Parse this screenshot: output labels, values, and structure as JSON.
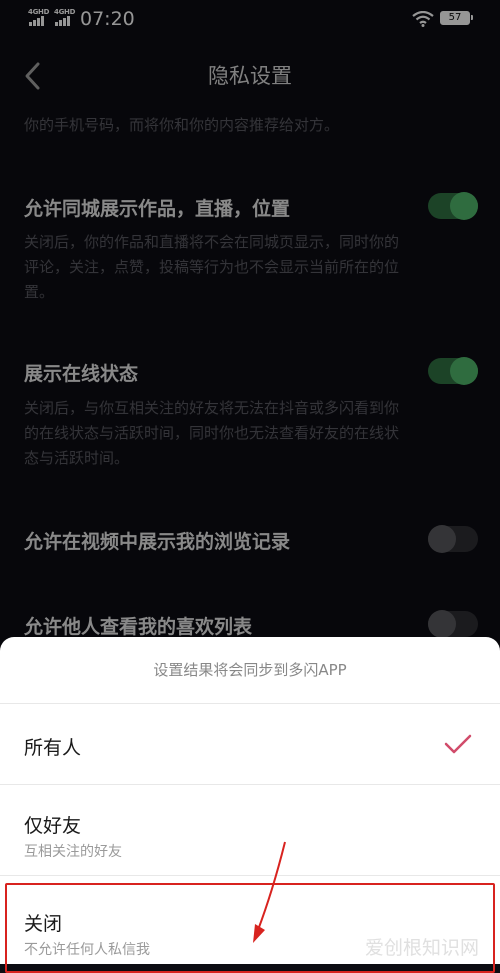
{
  "status_bar": {
    "signal_1_label": "4GHD",
    "signal_2_label": "4GHD",
    "time": "07:20",
    "battery": "57"
  },
  "nav": {
    "title": "隐私设置"
  },
  "settings": {
    "intro_text": "你的手机号码，而将你和你的内容推荐给对方。",
    "items": [
      {
        "title": "允许同城展示作品，直播，位置",
        "desc_lines": [
          "关闭后，你的作品和直播将不会在同城页显示，同时你的",
          "评论，关注，点赞，投稿等行为也不会显示当前所在的位",
          "置。"
        ],
        "enabled": true
      },
      {
        "title": "展示在线状态",
        "desc_lines": [
          "关闭后，与你互相关注的好友将无法在抖音或多闪看到你",
          "的在线状态与活跃时间，同时你也无法查看好友的在线状",
          "态与活跃时间。"
        ],
        "enabled": true
      },
      {
        "title": "允许在视频中展示我的浏览记录",
        "enabled": false
      },
      {
        "title": "允许他人查看我的喜欢列表",
        "enabled": false
      }
    ]
  },
  "sheet": {
    "header": "设置结果将会同步到多闪APP",
    "options": [
      {
        "label": "所有人",
        "selected": true
      },
      {
        "label": "仅好友",
        "sub": "互相关注的好友",
        "selected": false
      },
      {
        "label": "关闭",
        "sub": "不允许任何人私信我",
        "selected": false
      }
    ]
  },
  "colors": {
    "toggle_on": "#4caf66",
    "check": "#d14b6a",
    "highlight": "#d8231f"
  },
  "watermark": "爱创根知识网"
}
